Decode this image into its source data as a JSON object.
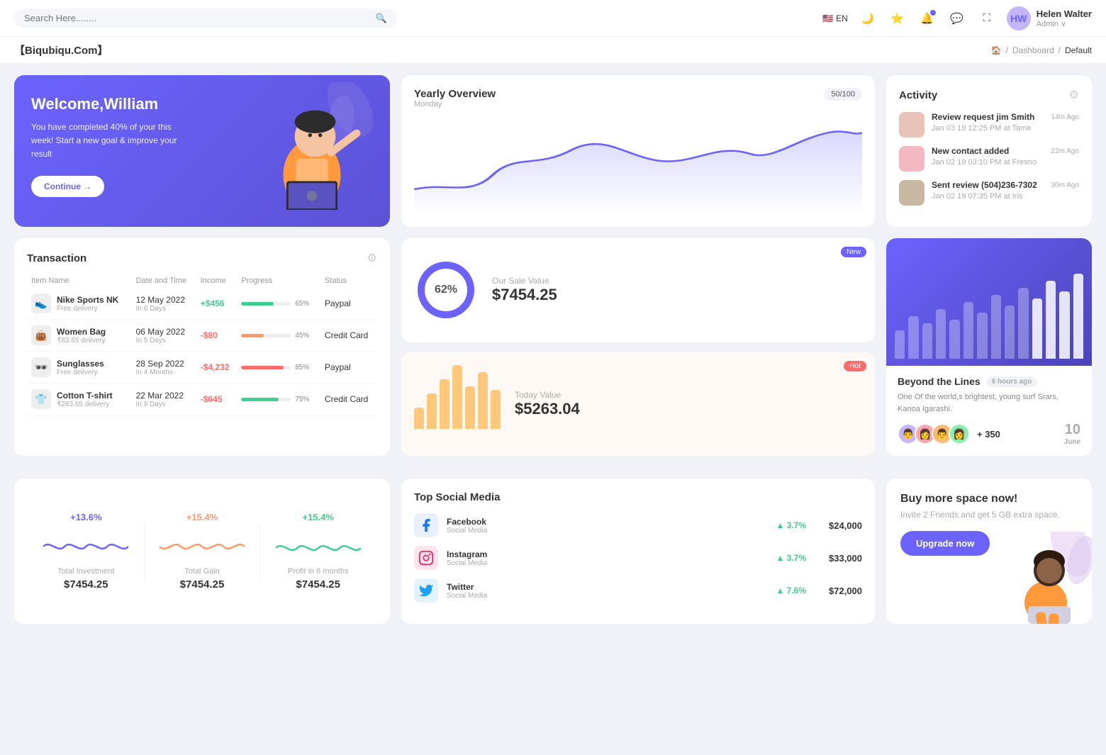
{
  "topnav": {
    "search_placeholder": "Search Here........",
    "lang": "EN",
    "user_name": "Helen Walter",
    "user_role": "Admin",
    "user_initials": "HW"
  },
  "breadcrumb": {
    "brand": "【Biqubiqu.Com】",
    "home": "🏠",
    "separator": "/",
    "dashboard": "Dashboard",
    "current": "Default"
  },
  "welcome": {
    "title": "Welcome,William",
    "desc": "You have completed 40% of your this week! Start a new goal & improve your result",
    "button": "Continue →"
  },
  "yearly": {
    "title": "Yearly Overview",
    "badge": "50/100",
    "sub": "Monday"
  },
  "activity": {
    "title": "Activity",
    "items": [
      {
        "title": "Review request jim Smith",
        "date": "Jan 03 19 12:25 PM at Tame",
        "time": "14m Ago",
        "color": "#e8c4b8"
      },
      {
        "title": "New contact added",
        "date": "Jan 02 19 03:10 PM at Fresno",
        "time": "22m Ago",
        "color": "#f4b8c1"
      },
      {
        "title": "Sent review (504)236-7302",
        "date": "Jan 02 19 07:35 PM at Iris",
        "time": "30m Ago",
        "color": "#c8b8a2"
      }
    ]
  },
  "transaction": {
    "title": "Transaction",
    "columns": [
      "Item Name",
      "Date and Time",
      "Income",
      "Progress",
      "Status"
    ],
    "rows": [
      {
        "icon": "👟",
        "name": "Nike Sports NK",
        "sub": "Free delivery",
        "date": "12 May 2022",
        "date_sub": "In 6 Days",
        "income": "+$456",
        "income_type": "pos",
        "progress": 65,
        "progress_color": "#3ecf8e",
        "status": "Paypal"
      },
      {
        "icon": "👜",
        "name": "Women Bag",
        "sub": "₹83.65 delivery",
        "date": "06 May 2022",
        "date_sub": "In 5 Days",
        "income": "-$80",
        "income_type": "neg",
        "progress": 45,
        "progress_color": "#ff9966",
        "status": "Credit Card"
      },
      {
        "icon": "🕶",
        "name": "Sunglasses",
        "sub": "Free delivery",
        "date": "28 Sep 2022",
        "date_sub": "In 4 Months",
        "income": "-$4,232",
        "income_type": "neg",
        "progress": 85,
        "progress_color": "#ff6b6b",
        "status": "Paypal"
      },
      {
        "icon": "👕",
        "name": "Cotton T-shirt",
        "sub": "₹283.65 delivery",
        "date": "22 Mar 2022",
        "date_sub": "In 8 Days",
        "income": "-$645",
        "income_type": "neg",
        "progress": 75,
        "progress_color": "#3ecf8e",
        "status": "Credit Card"
      }
    ]
  },
  "sale": {
    "donut_pct": "62%",
    "donut_value": 62,
    "label": "Our Sale Value",
    "value": "$7454.25",
    "badge": "New"
  },
  "today": {
    "label": "Today Value",
    "value": "$5263.04",
    "badge": "Hot",
    "bars": [
      30,
      50,
      70,
      90,
      60,
      80,
      55
    ]
  },
  "beyond": {
    "title": "Beyond the Lines",
    "ago": "6 hours ago",
    "desc": "One Of the world,s brightest, young surf Srars, Kanoa Igarashi.",
    "count": "+ 350",
    "date": "10",
    "date_month": "June",
    "bars": [
      40,
      60,
      50,
      70,
      55,
      80,
      65,
      90,
      75,
      100,
      85,
      110,
      95,
      120
    ]
  },
  "stats": [
    {
      "pct": "+13.6%",
      "color_class": "green",
      "label": "Total Investment",
      "value": "$7454.25"
    },
    {
      "pct": "+15.4%",
      "color_class": "orange",
      "label": "Total Gain",
      "value": "$7454.25"
    },
    {
      "pct": "+15.4%",
      "color_class": "lime",
      "label": "Profit in 6 months",
      "value": "$7454.25"
    }
  ],
  "social": {
    "title": "Top Social Media",
    "items": [
      {
        "name": "Facebook",
        "sub": "Social Media",
        "icon": "🔵",
        "growth": "3.7%",
        "value": "$24,000",
        "color": "#1877f2"
      },
      {
        "name": "Instagram",
        "sub": "Social Media",
        "icon": "📸",
        "growth": "3.7%",
        "value": "$33,000",
        "color": "#e1306c"
      },
      {
        "name": "Twitter",
        "sub": "Social Media",
        "icon": "🐦",
        "growth": "7.6%",
        "value": "$72,000",
        "color": "#1da1f2"
      }
    ]
  },
  "buy": {
    "title": "Buy more space now!",
    "desc": "Invite 2 Friends and get 5 GB extra space.",
    "button": "Upgrade now"
  }
}
